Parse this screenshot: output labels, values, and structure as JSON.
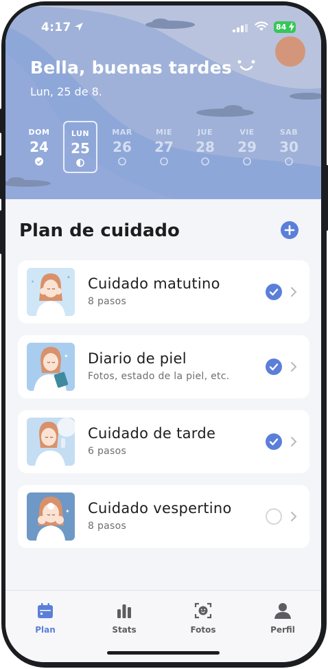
{
  "status": {
    "time": "4:17",
    "battery": "84"
  },
  "header": {
    "greeting": "Bella, buenas tardes",
    "date": "Lun, 25 de 8."
  },
  "week": [
    {
      "name": "DOM",
      "num": "24",
      "state": "done"
    },
    {
      "name": "LUN",
      "num": "25",
      "state": "current"
    },
    {
      "name": "MAR",
      "num": "26",
      "state": "future"
    },
    {
      "name": "MIE",
      "num": "27",
      "state": "future"
    },
    {
      "name": "JUE",
      "num": "28",
      "state": "future"
    },
    {
      "name": "VIE",
      "num": "29",
      "state": "future"
    },
    {
      "name": "SAB",
      "num": "30",
      "state": "future"
    }
  ],
  "plan": {
    "title": "Plan de cuidado",
    "items": [
      {
        "title": "Cuidado matutino",
        "subtitle": "8 pasos",
        "checked": true
      },
      {
        "title": "Diario de piel",
        "subtitle": "Fotos, estado de la piel, etc.",
        "checked": true
      },
      {
        "title": "Cuidado de tarde",
        "subtitle": "6 pasos",
        "checked": true
      },
      {
        "title": "Cuidado vespertino",
        "subtitle": "8 pasos",
        "checked": false
      }
    ]
  },
  "tabs": [
    {
      "label": "Plan",
      "icon": "calendar-icon",
      "active": true
    },
    {
      "label": "Stats",
      "icon": "bar-chart-icon",
      "active": false
    },
    {
      "label": "Fotos",
      "icon": "face-scan-icon",
      "active": false
    },
    {
      "label": "Perfil",
      "icon": "person-icon",
      "active": false
    }
  ],
  "colors": {
    "accent": "#5b7fd9",
    "header": "#9fb1d8",
    "battery": "#35c759"
  }
}
